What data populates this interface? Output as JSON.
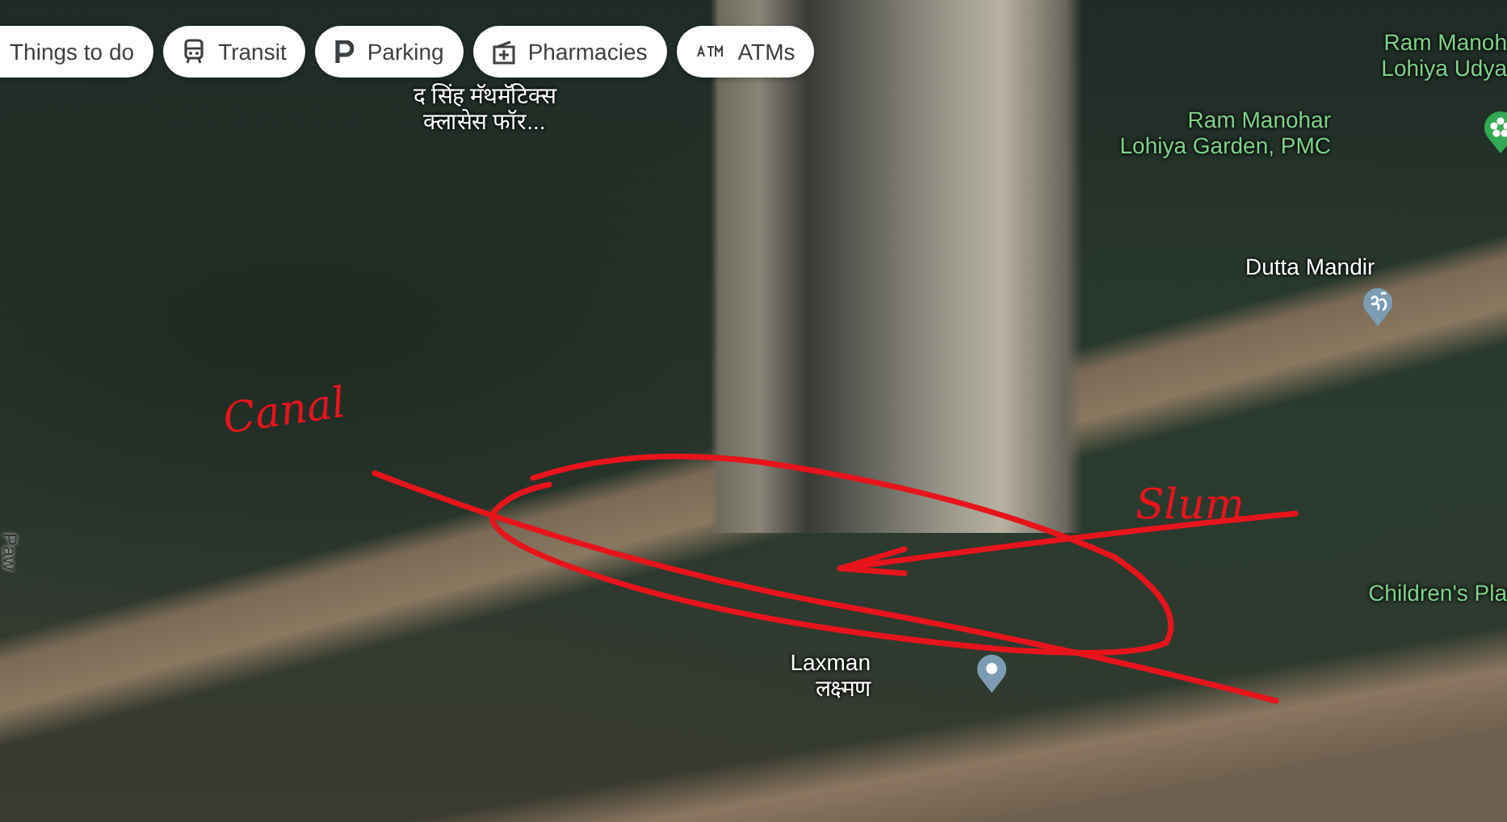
{
  "filter_chips": [
    {
      "label": "Things to do"
    },
    {
      "label": "Transit"
    },
    {
      "label": "Parking"
    },
    {
      "label": "Pharmacies"
    },
    {
      "label": "ATMs"
    }
  ],
  "map": {
    "places": [
      {
        "kind": "park",
        "lines": [
          "Ram Manoh",
          "Lohiya Udya"
        ]
      },
      {
        "kind": "park",
        "lines": [
          "Ram Manohar",
          "Lohiya Garden, PMC"
        ]
      },
      {
        "kind": "poi",
        "lines": [
          "Dutta Mandir"
        ]
      },
      {
        "kind": "park",
        "lines": [
          "Children's Pla"
        ]
      },
      {
        "kind": "poi",
        "lines": [
          "Laxman",
          "लक्ष्मण"
        ]
      },
      {
        "kind": "poi",
        "lines": [
          "द सिंह मॅथमॅटिक्स",
          "क्लासेस फॉर..."
        ]
      },
      {
        "kind": "road",
        "lines": [
          "Paw"
        ]
      }
    ]
  },
  "annotations": [
    {
      "kind": "label",
      "text": "Canal"
    },
    {
      "kind": "label",
      "text": "Slum"
    },
    {
      "kind": "line"
    },
    {
      "kind": "loop"
    },
    {
      "kind": "arrow"
    }
  ]
}
